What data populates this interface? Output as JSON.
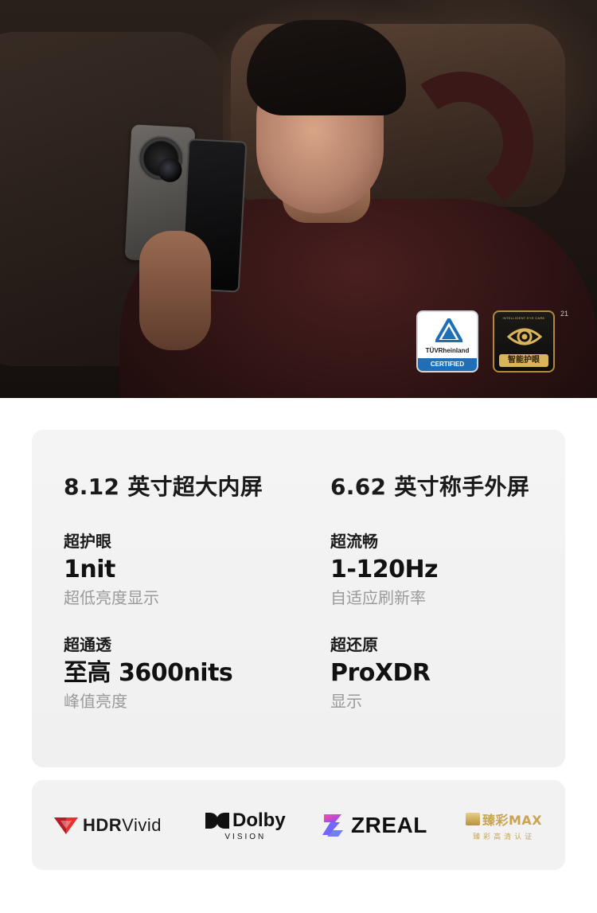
{
  "hero": {
    "badges": {
      "tuv_name": "TÜVRheinland",
      "tuv_certified": "CERTIFIED",
      "eye_care_top": "INTELLIGENT EYE CARE",
      "eye_care_label": "智能护眼",
      "footnote_mark": "21"
    }
  },
  "specs": {
    "left": {
      "title": "8.12 英寸超大内屏",
      "items": [
        {
          "label": "超护眼",
          "value": "1nit",
          "note": "超低亮度显示"
        },
        {
          "label": "超通透",
          "value": "至高 3600nits",
          "note": "峰值亮度"
        }
      ]
    },
    "right": {
      "title": "6.62 英寸称手外屏",
      "items": [
        {
          "label": "超流畅",
          "value": "1-120Hz",
          "note": "自适应刷新率"
        },
        {
          "label": "超还原",
          "value": "ProXDR",
          "note": "显示"
        }
      ]
    }
  },
  "logos": {
    "hdr_bold": "HDR",
    "hdr_light": "Vivid",
    "dolby": "Dolby",
    "dolby_sub": "VISION",
    "zreal": "ZREAL",
    "max": "臻彩MAX",
    "max_sub": "臻彩高清认证"
  },
  "colors": {
    "card_bg": "#f2f2f2",
    "note_gray": "#9a9a9a",
    "tuv_blue": "#1e6fb8",
    "gold": "#c9a456"
  }
}
